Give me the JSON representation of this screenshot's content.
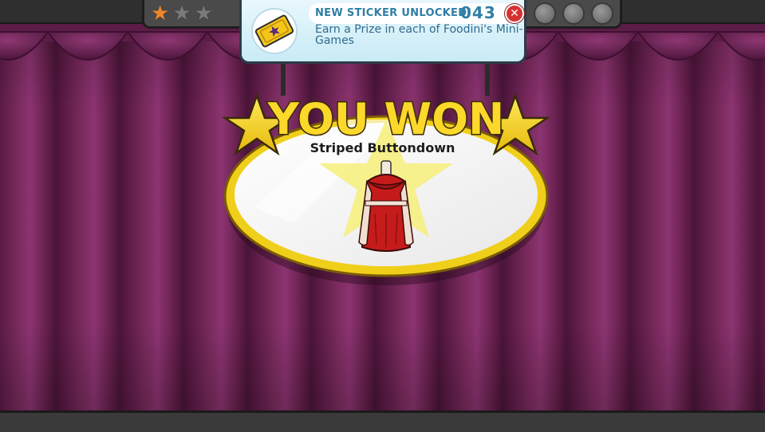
{
  "game": {
    "progress_stars": [
      {
        "icon": "star-icon",
        "earned": true
      },
      {
        "icon": "star-icon",
        "earned": false
      },
      {
        "icon": "star-icon",
        "earned": false
      }
    ],
    "progress_right_slots": 3
  },
  "sticker_notice": {
    "title": "NEW STICKER UNLOCKED!",
    "number": "043",
    "description": "Earn a Prize in each of Foodini's Mini-Games",
    "icon": "ticket-icon",
    "close_icon": "close-icon"
  },
  "prize": {
    "heading": "YOU WON",
    "item_name": "Striped Buttondown",
    "item_icon": "red-coat-icon"
  },
  "colors": {
    "curtain": "#6e2454",
    "board_gold": "#f2d21e",
    "notice_blue": "#2f7ea6",
    "close_red": "#d63232",
    "earned_star": "#f0862a"
  }
}
